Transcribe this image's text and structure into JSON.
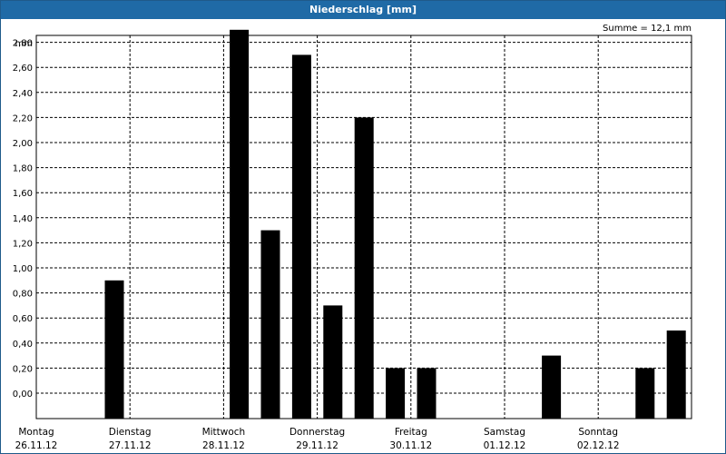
{
  "window": {
    "title": "Niederschlag [mm]"
  },
  "summary": "Summe = 12,1 mm",
  "chart_data": {
    "type": "bar",
    "title": "Niederschlag [mm]",
    "ylabel": "mm",
    "ylim": [
      0,
      3.0
    ],
    "yticks": [
      "0,00",
      "0,20",
      "0,40",
      "0,60",
      "0,80",
      "1,00",
      "1,20",
      "1,40",
      "1,60",
      "1,80",
      "2,00",
      "2,20",
      "2,40",
      "2,60",
      "2,80"
    ],
    "xticks": [
      {
        "day": "Montag",
        "date": "26.11.12"
      },
      {
        "day": "Dienstag",
        "date": "27.11.12"
      },
      {
        "day": "Mittwoch",
        "date": "28.11.12"
      },
      {
        "day": "Donnerstag",
        "date": "29.11.12"
      },
      {
        "day": "Freitag",
        "date": "30.11.12"
      },
      {
        "day": "Samstag",
        "date": "01.12.12"
      },
      {
        "day": "Sonntag",
        "date": "02.12.12"
      }
    ],
    "series": [
      {
        "values": [
          0,
          0,
          0,
          0.9,
          0,
          0,
          0,
          2.9,
          1.3,
          2.7,
          0.7,
          2.2,
          0.2,
          0.2,
          0,
          0,
          0,
          0.3,
          0,
          0,
          0.2,
          0.5
        ]
      }
    ],
    "bar_interval_hours": 8,
    "grid": true,
    "bar_color": "#000000",
    "total": "12,1"
  }
}
